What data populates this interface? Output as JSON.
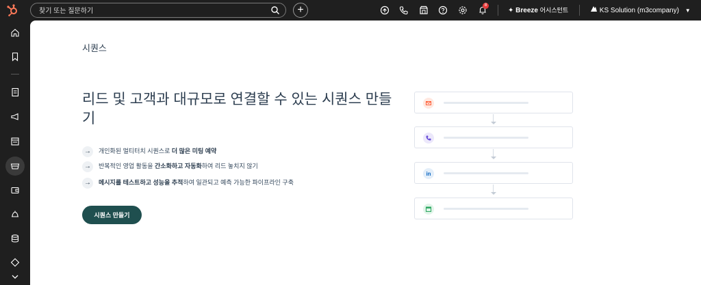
{
  "topbar": {
    "search_placeholder": "찾기 또는 질문하기",
    "breeze_label": "Breeze",
    "breeze_sub": "어시스턴트",
    "notification_count": "8",
    "account_name": "KS Solution (m3company)"
  },
  "sidebar": {
    "items": [
      "home",
      "bookmarks",
      "contacts",
      "marketing",
      "content",
      "sales",
      "commerce",
      "service",
      "data-management",
      "library"
    ]
  },
  "page": {
    "title": "시퀀스",
    "headline": "리드 및 고객과 대규모로 연결할 수 있는 시퀀스 만들기",
    "benefits": [
      {
        "pre": "개인화된 멀티터치 시퀀스로 ",
        "bold": "더 많은 미팅 예약",
        "post": ""
      },
      {
        "pre": "반복적인 영업 활동을 ",
        "bold": "간소화하고 자동화",
        "post": "하여 리드 놓치지 않기"
      },
      {
        "pre": "",
        "bold": "메시지를 테스트하고 성능을 추적",
        "post": "하여 일관되고 예측 가능한 파이프라인 구축"
      }
    ],
    "cta_label": "시퀀스 만들기"
  },
  "illustration": {
    "steps": [
      {
        "kind": "email",
        "color": "#ffe8e0",
        "icon_color": "#ff5c35"
      },
      {
        "kind": "call",
        "color": "#ece8fb",
        "icon_color": "#6a4fd8"
      },
      {
        "kind": "linkedin",
        "color": "#e3eef9",
        "icon_color": "#0a66c2"
      },
      {
        "kind": "task",
        "color": "#e3f5ea",
        "icon_color": "#2fa862"
      }
    ]
  },
  "colors": {
    "accent_dark_green": "#1f4f4f",
    "hubspot_orange": "#ff7a59"
  }
}
